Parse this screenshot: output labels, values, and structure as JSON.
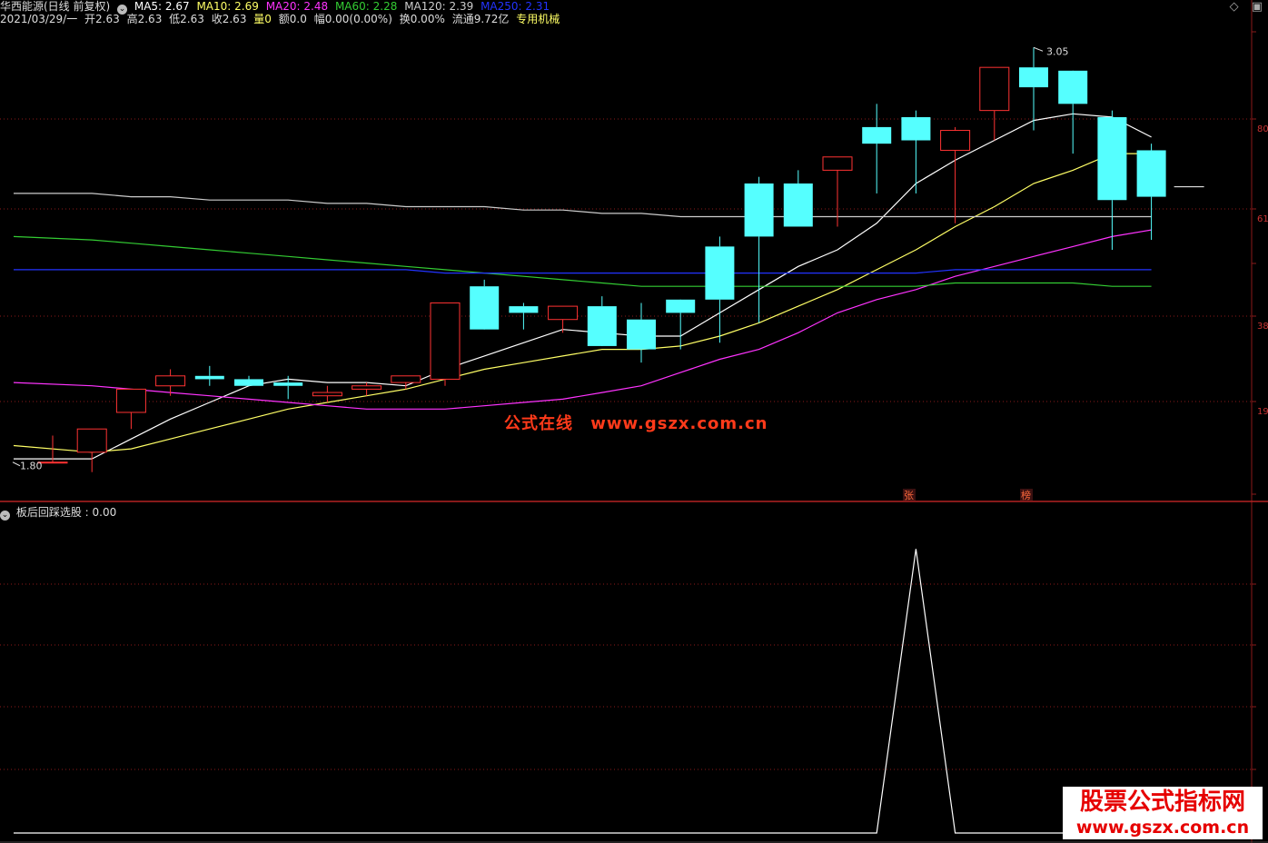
{
  "header": {
    "stock_title": "华西能源(日线 前复权)",
    "ma5": "MA5: 2.67",
    "ma10": "MA10: 2.69",
    "ma20": "MA20: 2.48",
    "ma60": "MA60: 2.28",
    "ma120": "MA120: 2.39",
    "ma250": "MA250: 2.31",
    "date": "2021/03/29/一",
    "open": "开2.63",
    "high": "高2.63",
    "low": "低2.63",
    "close": "收2.63",
    "volume": "量0",
    "amount": "额0.0",
    "change": "幅0.00(0.00%)",
    "turnover": "换0.00%",
    "float_cap": "流通9.72亿",
    "sector": "专用机械"
  },
  "colors": {
    "ma5": "#ffffff",
    "ma10": "#ffff66",
    "ma20": "#ff33ff",
    "ma60": "#33cc33",
    "ma120": "#cccccc",
    "ma250": "#2233ff",
    "up_candle": "#ff3333",
    "down_candle": "#55ffff",
    "grid": "#8b1a1a"
  },
  "price_labels": {
    "max": "3.05",
    "min": "1.80"
  },
  "y_axis_labels": [
    "80",
    "61",
    "38",
    "19"
  ],
  "tags": {
    "zhang": "张",
    "bang": "榜"
  },
  "indicator": {
    "label": "板后回踩选股 : 0.00"
  },
  "watermark": {
    "cn": "公式在线",
    "url": "www.gszx.com.cn"
  },
  "brand": {
    "title": "股票公式指标网",
    "url": "www.gszx.com.cn"
  },
  "window_controls": [
    "◇",
    "▣"
  ],
  "chart_data": [
    {
      "type": "candlestick",
      "series": [
        {
          "name": "K",
          "open": [
            1.8,
            1.83,
            1.95,
            2.03,
            2.06,
            2.05,
            2.04,
            2.0,
            2.02,
            2.04,
            2.05,
            2.33,
            2.27,
            2.23,
            2.27,
            2.23,
            2.29,
            2.45,
            2.64,
            2.64,
            2.68,
            2.81,
            2.84,
            2.74,
            2.86,
            2.99,
            2.98,
            2.84,
            2.74
          ],
          "high": [
            1.88,
            1.9,
            2.01,
            2.08,
            2.09,
            2.06,
            2.06,
            2.03,
            2.04,
            2.06,
            2.07,
            2.35,
            2.28,
            2.25,
            2.3,
            2.28,
            2.28,
            2.48,
            2.66,
            2.68,
            2.69,
            2.88,
            2.86,
            2.81,
            2.91,
            3.05,
            2.95,
            2.86,
            2.76
          ],
          "low": [
            1.8,
            1.77,
            1.9,
            2.0,
            2.03,
            2.03,
            1.99,
            1.98,
            2.0,
            2.02,
            2.03,
            2.27,
            2.2,
            2.19,
            2.19,
            2.1,
            2.14,
            2.16,
            2.22,
            2.51,
            2.51,
            2.61,
            2.61,
            2.52,
            2.77,
            2.8,
            2.73,
            2.44,
            2.47
          ],
          "close": [
            1.8,
            1.9,
            2.02,
            2.06,
            2.05,
            2.03,
            2.03,
            2.01,
            2.03,
            2.06,
            2.28,
            2.2,
            2.25,
            2.27,
            2.15,
            2.14,
            2.25,
            2.29,
            2.48,
            2.51,
            2.72,
            2.76,
            2.77,
            2.8,
            2.99,
            2.93,
            2.88,
            2.59,
            2.6
          ]
        }
      ],
      "moving_averages": {
        "MA5": [
          1.81,
          1.81,
          1.87,
          1.93,
          1.98,
          2.03,
          2.05,
          2.04,
          2.04,
          2.03,
          2.08,
          2.12,
          2.16,
          2.2,
          2.19,
          2.18,
          2.18,
          2.25,
          2.32,
          2.39,
          2.44,
          2.52,
          2.64,
          2.71,
          2.77,
          2.83,
          2.85,
          2.84,
          2.78
        ],
        "MA10": [
          1.85,
          1.83,
          1.84,
          1.87,
          1.9,
          1.93,
          1.96,
          1.98,
          2.0,
          2.02,
          2.05,
          2.08,
          2.1,
          2.12,
          2.14,
          2.14,
          2.15,
          2.18,
          2.22,
          2.27,
          2.32,
          2.38,
          2.44,
          2.51,
          2.57,
          2.64,
          2.68,
          2.73,
          2.73
        ],
        "MA20": [
          2.04,
          2.03,
          2.02,
          2.01,
          2.0,
          1.99,
          1.98,
          1.97,
          1.96,
          1.96,
          1.96,
          1.97,
          1.98,
          1.99,
          2.01,
          2.03,
          2.07,
          2.11,
          2.14,
          2.19,
          2.25,
          2.29,
          2.32,
          2.36,
          2.39,
          2.42,
          2.45,
          2.48,
          2.5
        ],
        "MA60": [
          2.48,
          2.47,
          2.46,
          2.45,
          2.44,
          2.43,
          2.42,
          2.41,
          2.4,
          2.39,
          2.38,
          2.37,
          2.36,
          2.35,
          2.34,
          2.33,
          2.33,
          2.33,
          2.33,
          2.33,
          2.33,
          2.33,
          2.33,
          2.34,
          2.34,
          2.34,
          2.34,
          2.33,
          2.33
        ],
        "MA120": [
          2.61,
          2.61,
          2.6,
          2.6,
          2.59,
          2.59,
          2.59,
          2.58,
          2.58,
          2.57,
          2.57,
          2.57,
          2.56,
          2.56,
          2.55,
          2.55,
          2.54,
          2.54,
          2.54,
          2.54,
          2.54,
          2.54,
          2.54,
          2.54,
          2.54,
          2.54,
          2.54,
          2.54,
          2.54
        ],
        "MA250": [
          2.38,
          2.38,
          2.38,
          2.38,
          2.38,
          2.38,
          2.38,
          2.38,
          2.38,
          2.38,
          2.37,
          2.37,
          2.37,
          2.37,
          2.37,
          2.37,
          2.37,
          2.37,
          2.37,
          2.37,
          2.37,
          2.37,
          2.37,
          2.38,
          2.38,
          2.38,
          2.38,
          2.38,
          2.38
        ]
      },
      "ylim": [
        1.75,
        3.1
      ]
    },
    {
      "type": "line",
      "series": [
        {
          "name": "板后回踩选股",
          "values": [
            0,
            0,
            0,
            0,
            0,
            0,
            0,
            0,
            0,
            0,
            0,
            0,
            0,
            0,
            0,
            0,
            0,
            0,
            0,
            0,
            0,
            0,
            1,
            0,
            0,
            0,
            0,
            0,
            0
          ]
        }
      ],
      "ylim": [
        0,
        1.1
      ]
    }
  ]
}
